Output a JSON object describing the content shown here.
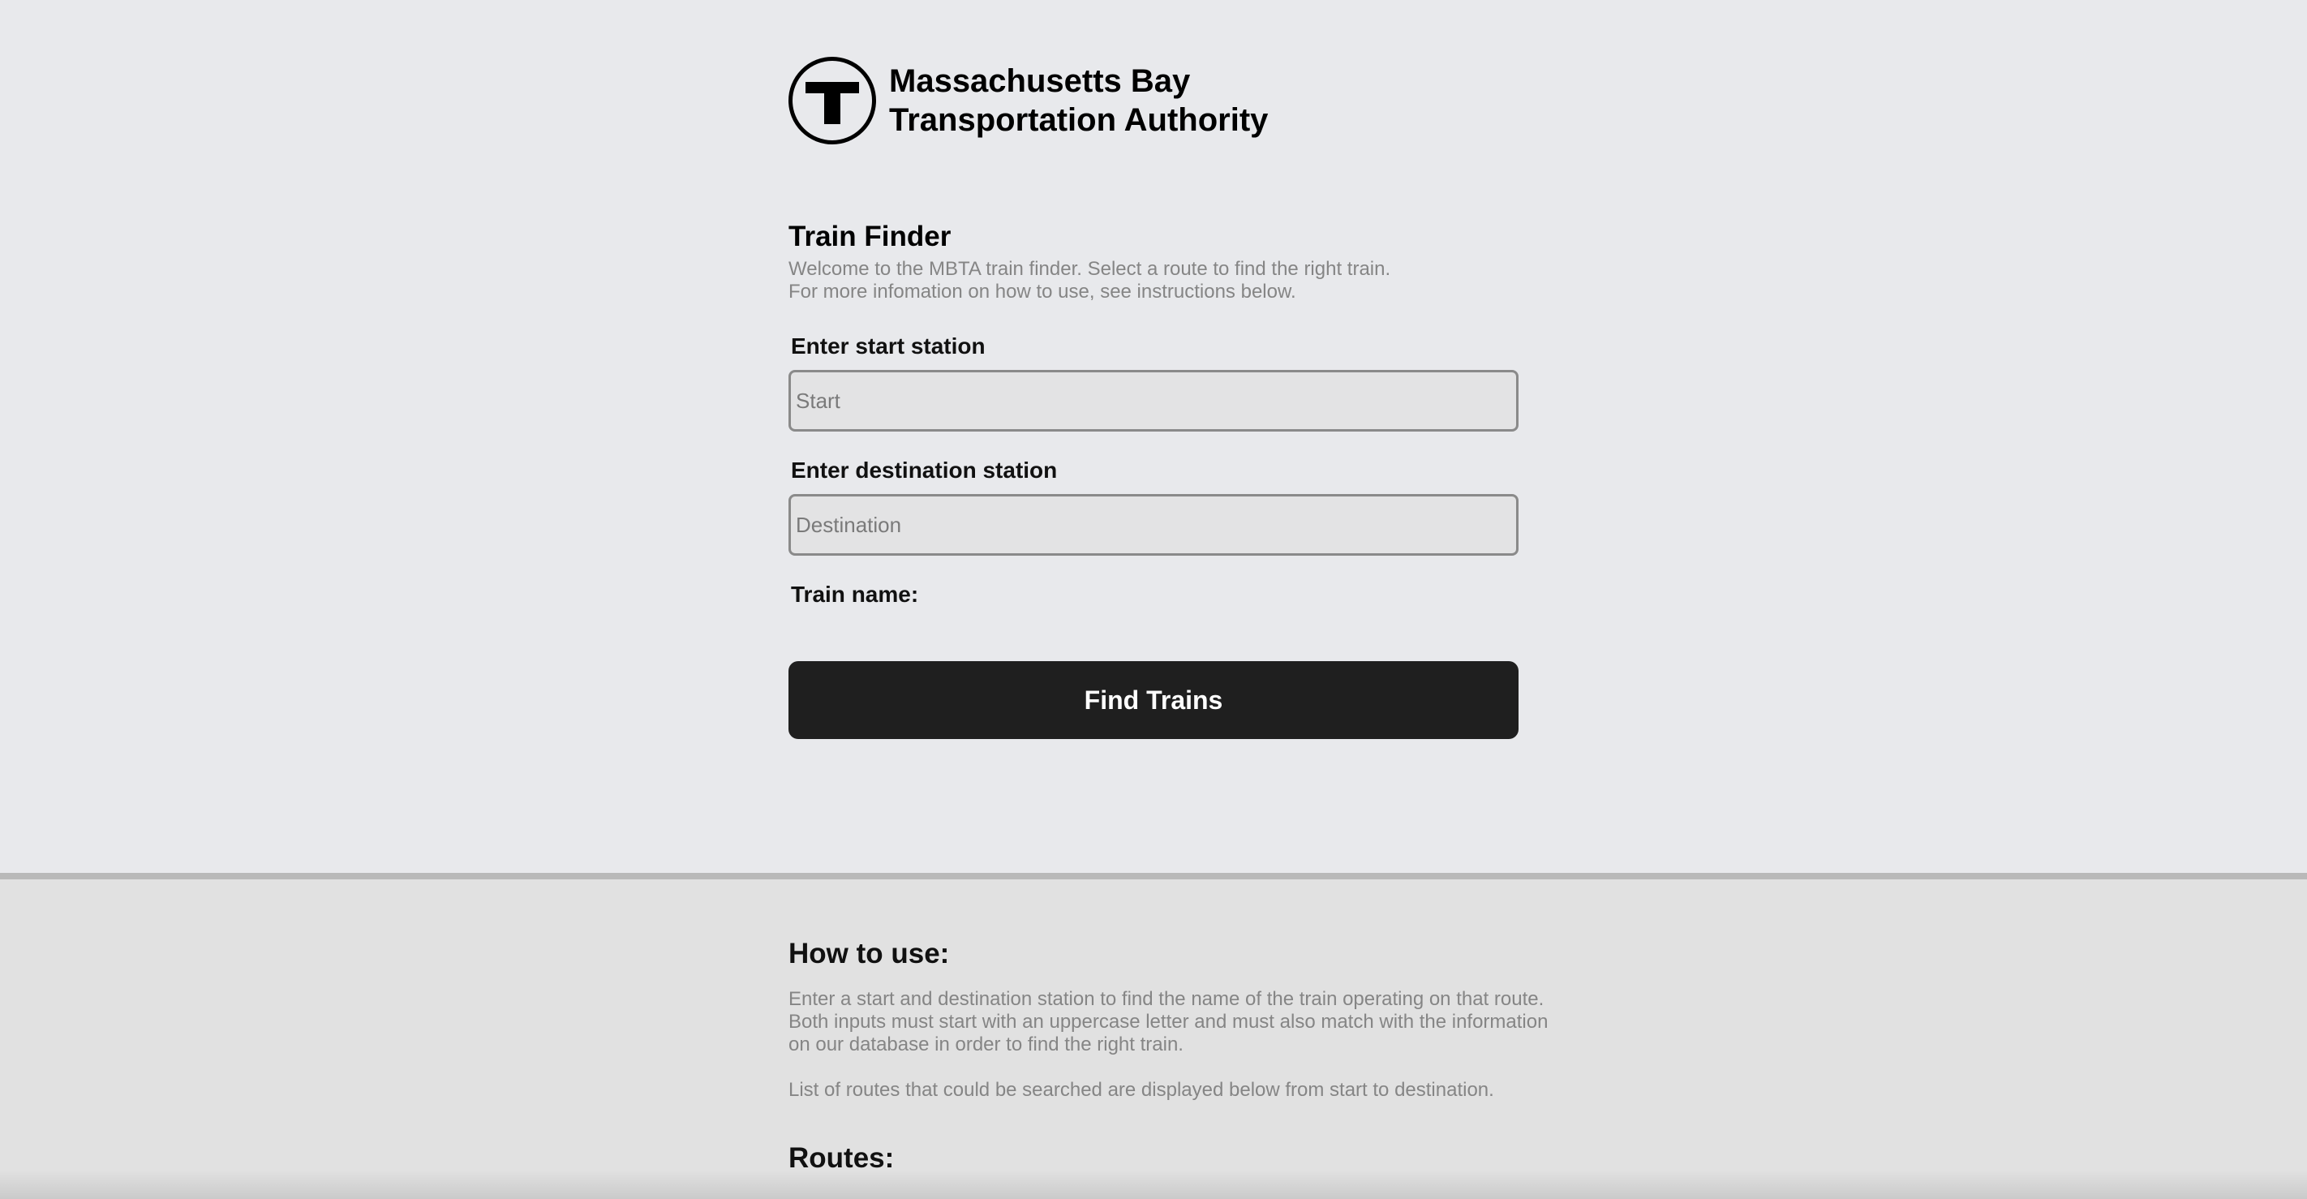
{
  "header": {
    "logo_icon": "mbta-t-logo-icon",
    "org_name_line1": "Massachusetts Bay",
    "org_name_line2": "Transportation Authority"
  },
  "finder": {
    "title": "Train Finder",
    "description_line1": "Welcome to the MBTA train finder. Select a route to find the right train.",
    "description_line2": "For more infomation on how to use, see instructions below.",
    "start": {
      "label": "Enter start station",
      "placeholder": "Start",
      "value": ""
    },
    "destination": {
      "label": "Enter destination station",
      "placeholder": "Destination",
      "value": ""
    },
    "train_name_label": "Train name:",
    "train_name_value": "",
    "find_button_label": "Find Trains"
  },
  "instructions": {
    "title": "How to use:",
    "paragraph1": "Enter a start and destination station to find the name of the train operating on that route. Both inputs must start with an uppercase letter and must also match with the information on our database in order to find the right train.",
    "paragraph2": "List of routes that could be searched are displayed below from start to destination.",
    "routes_title": "Routes:"
  },
  "colors": {
    "page_background": "#e8e9ec",
    "lower_background": "#e1e1e1",
    "button_background": "#1f1f1f",
    "muted_text": "#858585"
  }
}
